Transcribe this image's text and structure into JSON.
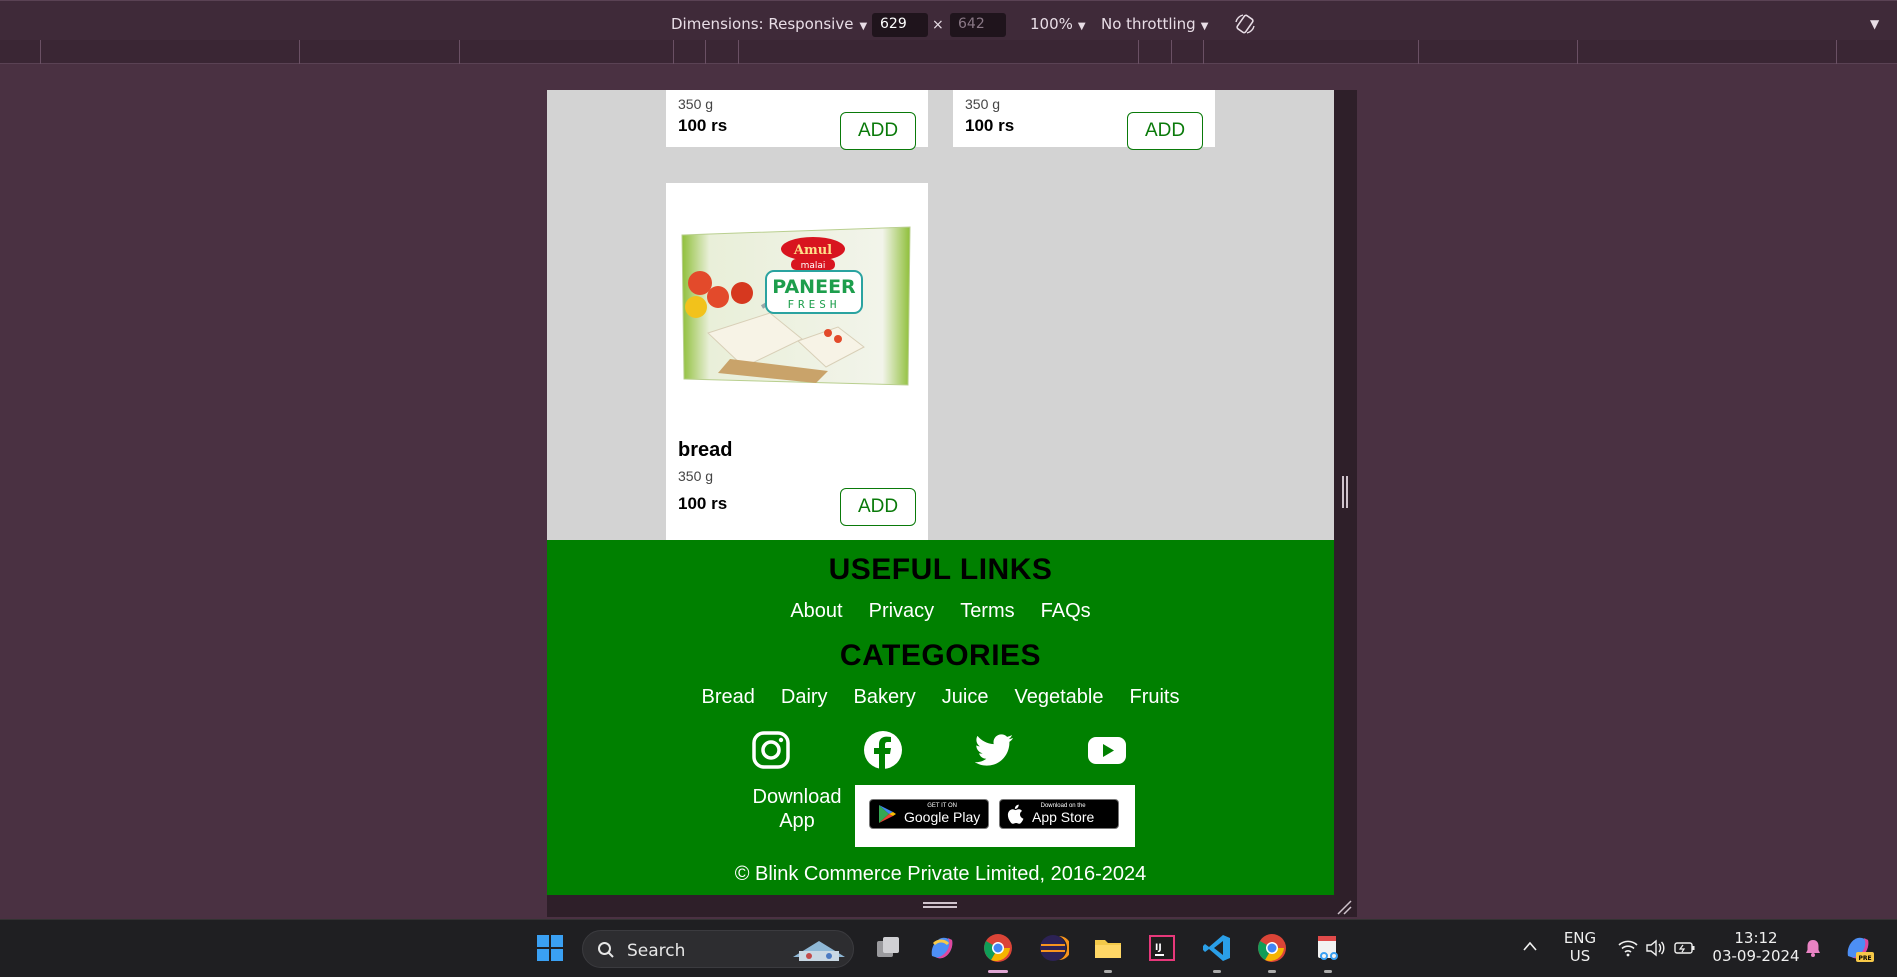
{
  "devtools": {
    "dimensions_label": "Dimensions: Responsive",
    "width_value": "629",
    "height_value": "642",
    "times": "×",
    "zoom": "100%",
    "throttling": "No throttling"
  },
  "products": [
    {
      "weight": "350 g",
      "price": "100 rs",
      "add_label": "ADD"
    },
    {
      "weight": "350 g",
      "price": "100 rs",
      "add_label": "ADD"
    },
    {
      "name": "bread",
      "weight": "350 g",
      "price": "100 rs",
      "add_label": "ADD",
      "image_text": {
        "brand": "Amul",
        "variant": "malai",
        "product": "PANEER",
        "sub": "FRESH"
      }
    }
  ],
  "footer": {
    "useful_links_title": "USEFUL LINKS",
    "useful_links": [
      "About",
      "Privacy",
      "Terms",
      "FAQs"
    ],
    "categories_title": "CATEGORIES",
    "categories": [
      "Bread",
      "Dairy",
      "Bakery",
      "Juice",
      "Vegetable",
      "Fruits"
    ],
    "social_icons": [
      "instagram-icon",
      "facebook-icon",
      "twitter-icon",
      "youtube-icon"
    ],
    "download_label": "Download App",
    "google_play": {
      "small": "GET IT ON",
      "big": "Google Play"
    },
    "app_store": {
      "small": "Download on the",
      "big": "App Store"
    },
    "copyright": "© Blink Commerce Private Limited, 2016-2024"
  },
  "taskbar": {
    "search_label": "Search",
    "language": "ENG",
    "region": "US",
    "time": "13:12",
    "date": "03-09-2024"
  },
  "colors": {
    "footer_green": "#008000",
    "add_green": "#0a7a0a",
    "page_gray": "#d3d3d3",
    "devtools_bg": "#4a3142"
  }
}
